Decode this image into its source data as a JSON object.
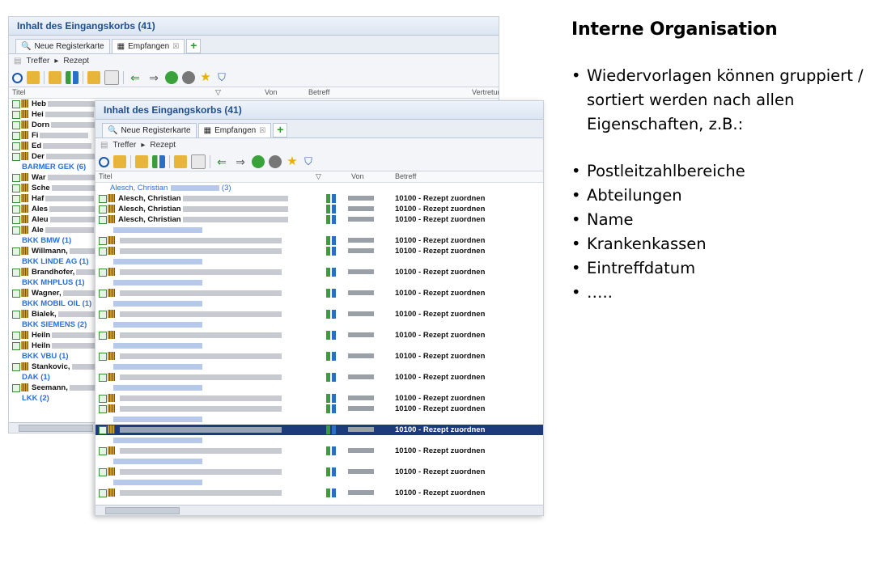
{
  "back_window": {
    "title": "Inhalt des Eingangskorbs (41)",
    "tabs": [
      {
        "label": "Neue Registerkarte"
      },
      {
        "label": "Empfangen"
      }
    ],
    "add_tab": "+",
    "crumbs": [
      "Treffer",
      "Rezept"
    ],
    "columns": [
      "Titel",
      "Von",
      "Betreff",
      "Vertretur"
    ],
    "list": [
      {
        "type": "row",
        "text": "Heb"
      },
      {
        "type": "row",
        "text": "Hei"
      },
      {
        "type": "row",
        "text": "Dorn"
      },
      {
        "type": "row",
        "text": "Fi"
      },
      {
        "type": "row",
        "text": "Ed"
      },
      {
        "type": "row",
        "text": "Der"
      },
      {
        "type": "group",
        "text": "BARMER GEK (6)"
      },
      {
        "type": "row",
        "text": "War"
      },
      {
        "type": "row",
        "text": "Sche"
      },
      {
        "type": "row",
        "text": "Haf"
      },
      {
        "type": "row",
        "text": "Ales"
      },
      {
        "type": "row",
        "text": "Aleu"
      },
      {
        "type": "row",
        "text": "Ale"
      },
      {
        "type": "group",
        "text": "BKK BMW (1)"
      },
      {
        "type": "row",
        "text": "Willmann,"
      },
      {
        "type": "group",
        "text": "BKK LINDE AG (1)"
      },
      {
        "type": "row",
        "text": "Brandhofer,"
      },
      {
        "type": "group",
        "text": "BKK MHPLUS (1)"
      },
      {
        "type": "row",
        "text": "Wagner,"
      },
      {
        "type": "group",
        "text": "BKK MOBIL OIL (1)"
      },
      {
        "type": "row",
        "text": "Bialek,"
      },
      {
        "type": "group",
        "text": "BKK SIEMENS (2)"
      },
      {
        "type": "row",
        "text": "Heiln"
      },
      {
        "type": "row",
        "text": "Heiln"
      },
      {
        "type": "group",
        "text": "BKK VBU (1)"
      },
      {
        "type": "row",
        "text": "Stankovic,"
      },
      {
        "type": "group",
        "text": "DAK (1)"
      },
      {
        "type": "row",
        "text": "Seemann,"
      },
      {
        "type": "group",
        "text": "LKK (2)"
      }
    ]
  },
  "front_window": {
    "title": "Inhalt des Eingangskorbs (41)",
    "tabs": [
      {
        "label": "Neue Registerkarte"
      },
      {
        "label": "Empfangen"
      }
    ],
    "add_tab": "+",
    "crumbs": [
      "Treffer",
      "Rezept"
    ],
    "columns": [
      "Titel",
      "Von",
      "Betreff"
    ],
    "group_first": "Alesch, Christian",
    "group_first_count": "(3)",
    "list": [
      {
        "type": "row",
        "name": "Alesch, Christian",
        "betreff": "10100 - Rezept zuordnen"
      },
      {
        "type": "row",
        "name": "Alesch, Christian",
        "betreff": "10100 - Rezept zuordnen"
      },
      {
        "type": "row",
        "name": "Alesch, Christian",
        "betreff": "10100 - Rezept zuordnen"
      },
      {
        "type": "group"
      },
      {
        "type": "row",
        "name": "",
        "betreff": "10100 - Rezept zuordnen"
      },
      {
        "type": "row",
        "name": "",
        "betreff": "10100 - Rezept zuordnen"
      },
      {
        "type": "group"
      },
      {
        "type": "row",
        "name": "",
        "betreff": "10100 - Rezept zuordnen"
      },
      {
        "type": "group"
      },
      {
        "type": "row",
        "name": "",
        "betreff": "10100 - Rezept zuordnen"
      },
      {
        "type": "group"
      },
      {
        "type": "row",
        "name": "",
        "betreff": "10100 - Rezept zuordnen"
      },
      {
        "type": "group"
      },
      {
        "type": "row",
        "name": "",
        "betreff": "10100 - Rezept zuordnen"
      },
      {
        "type": "group"
      },
      {
        "type": "row",
        "name": "",
        "betreff": "10100 - Rezept zuordnen"
      },
      {
        "type": "group"
      },
      {
        "type": "row",
        "name": "",
        "betreff": "10100 - Rezept zuordnen"
      },
      {
        "type": "group"
      },
      {
        "type": "row",
        "name": "",
        "betreff": "10100 - Rezept zuordnen"
      },
      {
        "type": "row",
        "name": "",
        "betreff": "10100 - Rezept zuordnen"
      },
      {
        "type": "group"
      },
      {
        "type": "row",
        "name": "",
        "betreff": "10100 - Rezept zuordnen",
        "selected": true
      },
      {
        "type": "group"
      },
      {
        "type": "row",
        "name": "",
        "betreff": "10100 - Rezept zuordnen"
      },
      {
        "type": "group"
      },
      {
        "type": "row",
        "name": "",
        "betreff": "10100 - Rezept zuordnen"
      },
      {
        "type": "group"
      },
      {
        "type": "row",
        "name": "",
        "betreff": "10100 - Rezept zuordnen"
      }
    ]
  },
  "slide": {
    "heading": "Interne Organisation",
    "intro": "Wiedervorlagen können gruppiert / sortiert werden nach allen Eigenschaften, z.B.:",
    "intro_lines": [
      "Wiedervorlagen können gruppiert /",
      "sortiert werden nach allen",
      "Eigenschaften, z.B.:"
    ],
    "items": [
      "Postleitzahlbereiche",
      "Abteilungen",
      "Name",
      "Krankenkassen",
      "Eintreffdatum",
      "….."
    ]
  },
  "colors": {
    "group_blue": "#2a6fd6",
    "title_blue": "#1f4e8c",
    "selected_row": "#1d3a7a"
  }
}
